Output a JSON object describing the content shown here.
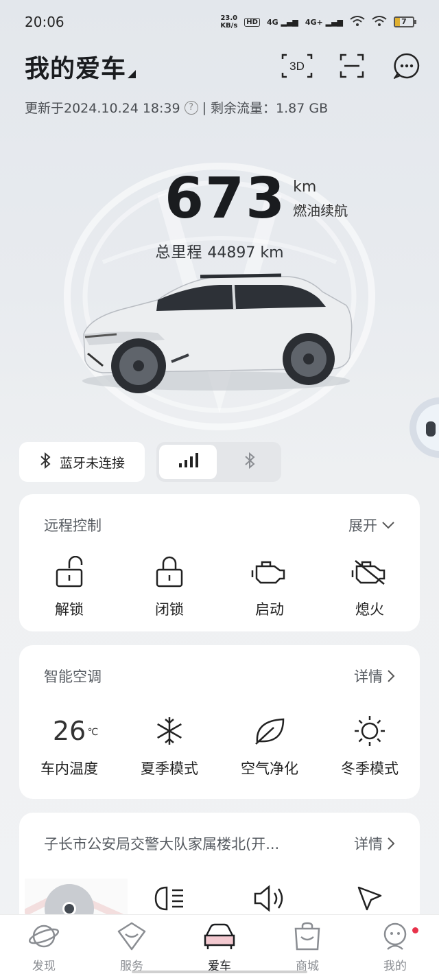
{
  "status_bar": {
    "time": "20:06",
    "net_speed_value": "23.0",
    "net_speed_unit": "KB/s",
    "hd_badge": "HD",
    "sig1": "4G",
    "sig2": "4G+",
    "battery": "7"
  },
  "header": {
    "title": "我的爱车",
    "icon_3d": "3D",
    "icons": [
      "3d-view-icon",
      "scan-icon",
      "message-icon"
    ]
  },
  "update_info": {
    "updated": "更新于2024.10.24 18:39",
    "help": "?",
    "separator": "|",
    "data_left": "剩余流量：1.87 GB"
  },
  "range": {
    "value": "673",
    "unit": "km",
    "label": "燃油续航",
    "odometer_label": "总里程",
    "odometer_value": "44897 km"
  },
  "connection": {
    "bluetooth_status": "蓝牙未连接",
    "toggle_options": [
      "cellular-signal",
      "bluetooth"
    ],
    "active_option": "cellular-signal"
  },
  "remote_control": {
    "title": "远程控制",
    "expand_label": "展开",
    "items": [
      {
        "label": "解锁",
        "icon": "unlock-icon"
      },
      {
        "label": "闭锁",
        "icon": "lock-icon"
      },
      {
        "label": "启动",
        "icon": "engine-start-icon"
      },
      {
        "label": "熄火",
        "icon": "engine-off-icon"
      }
    ]
  },
  "climate": {
    "title": "智能空调",
    "details_label": "详情",
    "temperature": "26",
    "temp_unit": "℃",
    "items": [
      {
        "label": "车内温度"
      },
      {
        "label": "夏季模式",
        "icon": "snowflake-icon"
      },
      {
        "label": "空气净化",
        "icon": "leaf-icon"
      },
      {
        "label": "冬季模式",
        "icon": "sun-icon"
      }
    ]
  },
  "location": {
    "title": "子长市公安局交警大队家属楼北(开...",
    "details_label": "详情",
    "items": [
      {
        "icon": "headlight-icon"
      },
      {
        "icon": "horn-icon"
      },
      {
        "icon": "navigate-icon"
      }
    ]
  },
  "tabbar": {
    "tabs": [
      {
        "label": "发现",
        "icon": "planet-icon"
      },
      {
        "label": "服务",
        "icon": "service-icon"
      },
      {
        "label": "爱车",
        "icon": "car-icon"
      },
      {
        "label": "商城",
        "icon": "shopping-bag-icon"
      },
      {
        "label": "我的",
        "icon": "profile-icon"
      }
    ],
    "active": "爱车"
  },
  "colors": {
    "accent": "#e8324a",
    "text_primary": "#1a1c1f",
    "card_bg": "#ffffff",
    "page_bg": "#e8ebef"
  }
}
